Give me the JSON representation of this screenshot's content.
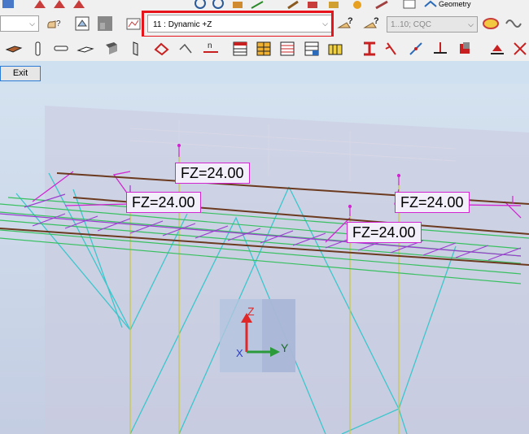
{
  "toolbar": {
    "view_mode": "Geometry",
    "load_case": {
      "value": "11 : Dynamic +Z"
    },
    "combination": {
      "value": "1..10; CQC"
    }
  },
  "exit_label": "Exit",
  "load_labels": [
    "FZ=24.00",
    "FZ=24.00",
    "FZ=24.00",
    "FZ=24.00"
  ],
  "axes": {
    "z": "Z",
    "y": "Y",
    "x": "X"
  },
  "colors": {
    "highlight": "#e8141c",
    "beam_brown": "#6b3a1f",
    "brace_cyan": "#3cc6cc",
    "column_yellow": "#c8c84a",
    "slab_green": "#38c060",
    "slab_purple": "#9c3dd2",
    "load_magenta": "#d226d2"
  }
}
